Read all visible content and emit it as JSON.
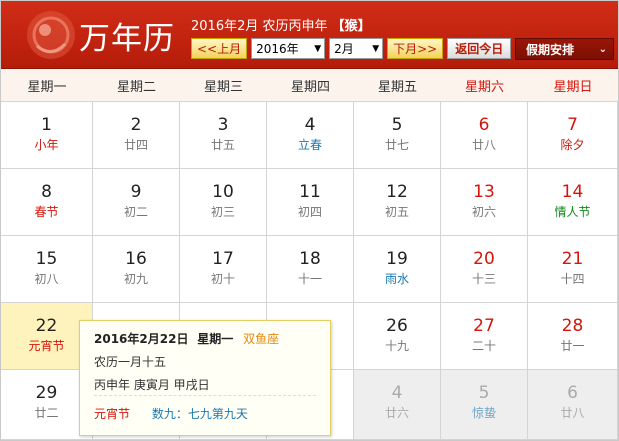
{
  "header": {
    "title": "万年历",
    "summary_prefix": "2016年2月 农历丙申年",
    "summary_zodiac": "【猴】",
    "prev_month": "<<上月",
    "year_value": "2016年",
    "month_value": "2月",
    "next_month": "下月>>",
    "today_button": "返回今日",
    "holiday_label": "假期安排"
  },
  "weekdays": [
    "星期一",
    "星期二",
    "星期三",
    "星期四",
    "星期五",
    "星期六",
    "星期日"
  ],
  "weeks": [
    [
      {
        "g": "1",
        "l": "小年"
      },
      {
        "g": "2",
        "l": "廿四"
      },
      {
        "g": "3",
        "l": "廿五"
      },
      {
        "g": "4",
        "l": "立春"
      },
      {
        "g": "5",
        "l": "廿七"
      },
      {
        "g": "6",
        "l": "廿八"
      },
      {
        "g": "7",
        "l": "除夕"
      }
    ],
    [
      {
        "g": "8",
        "l": "春节"
      },
      {
        "g": "9",
        "l": "初二"
      },
      {
        "g": "10",
        "l": "初三"
      },
      {
        "g": "11",
        "l": "初四"
      },
      {
        "g": "12",
        "l": "初五"
      },
      {
        "g": "13",
        "l": "初六"
      },
      {
        "g": "14",
        "l": "情人节"
      }
    ],
    [
      {
        "g": "15",
        "l": "初八"
      },
      {
        "g": "16",
        "l": "初九"
      },
      {
        "g": "17",
        "l": "初十"
      },
      {
        "g": "18",
        "l": "十一"
      },
      {
        "g": "19",
        "l": "雨水"
      },
      {
        "g": "20",
        "l": "十三"
      },
      {
        "g": "21",
        "l": "十四"
      }
    ],
    [
      {
        "g": "22",
        "l": "元宵节"
      },
      {
        "g": "",
        "l": ""
      },
      {
        "g": "",
        "l": ""
      },
      {
        "g": "",
        "l": ""
      },
      {
        "g": "26",
        "l": "十九"
      },
      {
        "g": "27",
        "l": "二十"
      },
      {
        "g": "28",
        "l": "廿一"
      }
    ],
    [
      {
        "g": "29",
        "l": "廿二"
      },
      {
        "g": "",
        "l": ""
      },
      {
        "g": "",
        "l": ""
      },
      {
        "g": "",
        "l": ""
      },
      {
        "g": "4",
        "l": "廿六"
      },
      {
        "g": "5",
        "l": "惊蛰"
      },
      {
        "g": "6",
        "l": "廿八"
      }
    ]
  ],
  "popup": {
    "date": "2016年2月22日",
    "weekday": "星期一",
    "zodiac": "双鱼座",
    "lunar": "农历一月十五",
    "ganzhi": "丙申年 庚寅月 甲戌日",
    "festival": "元宵节",
    "shujiu": "数九：七九第九天"
  },
  "colors": {
    "header_red": "#c8250f",
    "weekend_red": "#d4150b",
    "solar_term_blue": "#1a78b3",
    "today_bg": "#fff3bd"
  }
}
